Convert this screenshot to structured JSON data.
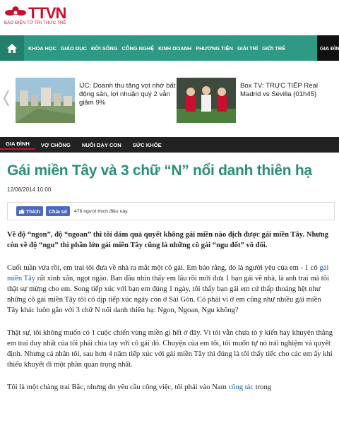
{
  "logo": {
    "name": "TTVN",
    "tagline": "BÁO ĐIỆN TỬ TRI THỨC TRẺ"
  },
  "nav": {
    "items": [
      "KHOA HỌC",
      "GIÁO DỤC",
      "ĐỜI SỐNG",
      "CÔNG NGHỆ",
      "KINH DOANH",
      "PHƯƠNG TIỆN",
      "GIẢI TRÍ",
      "GIỚI TRẺ"
    ],
    "last": "GIA ĐÌNH"
  },
  "promo": {
    "item1": "IJC: Doanh thu tăng vọt nhờ bất động sản, lợi nhuận quý 2 vẫn giảm 9%",
    "item2": "Box TV: TRỰC TIẾP Real Madrid vs Sevilla (01h45)"
  },
  "subnav": {
    "items": [
      "GIA ĐÌNH",
      "VỢ CHỒNG",
      "NUÔI DẠY CON",
      "SỨC KHỎE"
    ]
  },
  "article": {
    "title": "Gái miền Tây và 3 chữ “N” nổi danh thiên hạ",
    "date": "12/08/2014 10:00",
    "social": {
      "like": "Thích",
      "share": "Chia sẻ",
      "count": "476 người thích điều này."
    },
    "lead": "Về độ “ngon”, độ “ngoan” thì tôi dám quả quyết không gái miền nào địch được gái miền Tây. Nhưng còn về độ “ngu” thì phần lớn gái miền Tây cũng là những cô gái “ngu đốt” vô đối.",
    "p1_before": "Cuối tuần vừa rồi, em trai tôi đưa về nhà ra mắt một cô gái. Em bảo rằng, đó là người yêu của em - 1 cô ",
    "p1_link": "gái miền Tây",
    "p1_after": " rất xinh xắn, ngọt ngào. Ban đầu nhìn thấy em lâu rồi mới đưa 1 bạn gái về nhà, là anh trai mà tôi thật sự mừng cho em. Song tiếp xúc với bạn em đúng 1 ngày, tôi thấy bạn gái em cứ thấp thoáng hệt như những cô gái miền Tây tôi có dịp tiếp xúc ngày còn ở Sài Gòn. Có phải vì ở em cũng như nhiều gái miền Tây khác luôn gắn với 3 chữ N nổi danh thiên hạ: Ngon, Ngoan, Ngu không?",
    "p2": "Thật sự, tôi không muốn có 1 cuộc chiến vùng miền gì hết ở đây. Vì tôi vẫn chưa tỏ ý kiến hay khuyên thẳng em trai duy nhất của tôi phải chia tay với cô gái đó. Chuyện của em tôi, tôi muốn tự nó trải nghiệm và quyết định. Nhưng cá nhân tôi, sau hơn 4 năm tiếp xúc với gái miền Tây thì đúng là tôi thấy tiếc cho các em ấy khi thiếu khuyết đi một phần quan trọng nhất.",
    "p3_before": "Tôi là một chàng trai Bắc, nhưng do yêu cầu công việc, tôi phải vào Nam ",
    "p3_link": "công tác",
    "p3_after": " trong"
  }
}
